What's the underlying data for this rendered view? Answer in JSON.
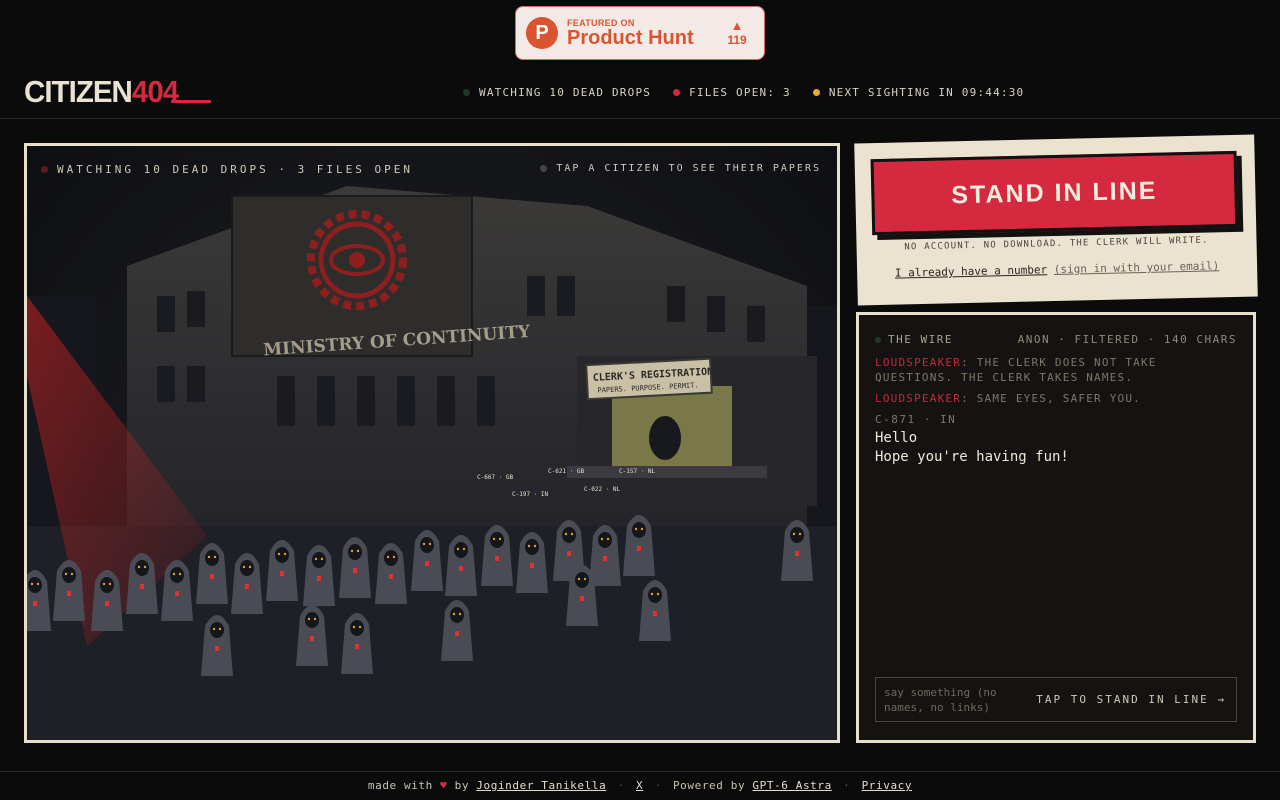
{
  "product_hunt": {
    "small": "FEATURED ON",
    "name": "Product Hunt",
    "votes": "119",
    "logo_letter": "P"
  },
  "header": {
    "logo_a": "CITIZEN",
    "logo_b": "404",
    "status": [
      {
        "label": "WATCHING 10 DEAD DROPS",
        "color": "#1f3a2a"
      },
      {
        "label": "FILES OPEN: 3",
        "color": "#d4293f"
      },
      {
        "label": "NEXT SIGHTING IN 09:44:30",
        "color": "#e8a93a"
      }
    ]
  },
  "scene": {
    "caption_left": "WATCHING 10 DEAD DROPS · 3 FILES OPEN",
    "caption_right": "TAP A CITIZEN TO SEE THEIR PAPERS",
    "building_sign": "MINISTRY OF CONTINUITY",
    "booth_sign_1": "CLERK'S REGISTRATION",
    "booth_sign_2": "PAPERS. PURPOSE. PERMIT.",
    "tags": [
      "C-667 · GB",
      "C-621 · GB",
      "C-157 · NL",
      "C-197 · IN",
      "C-022 · NL"
    ]
  },
  "card": {
    "button": "STAND IN LINE",
    "sub": "NO ACCOUNT. NO DOWNLOAD. THE CLERK WILL WRITE.",
    "link_main": "I already have a number",
    "link_muted": "(sign in with your email)"
  },
  "wire": {
    "title": "THE WIRE",
    "meta": "ANON · FILTERED · 140 CHARS",
    "messages": [
      {
        "who": "LOUDSPEAKER",
        "text": ": THE CLERK DOES NOT TAKE QUESTIONS. THE CLERK TAKES NAMES."
      },
      {
        "who": "LOUDSPEAKER",
        "text": ": SAME EYES, SAFER YOU."
      }
    ],
    "user_id": "C-871 · IN",
    "user_lines": [
      "Hello",
      "Hope you're having fun!"
    ],
    "input_placeholder": "say something (no names, no links)",
    "cta": "TAP TO STAND IN LINE →"
  },
  "footer": {
    "made_with": "made with",
    "heart": "♥",
    "by": "by",
    "author": "Joginder Tanikella",
    "x": "X",
    "powered_by": "Powered by",
    "engine": "GPT-6 Astra",
    "privacy": "Privacy"
  }
}
